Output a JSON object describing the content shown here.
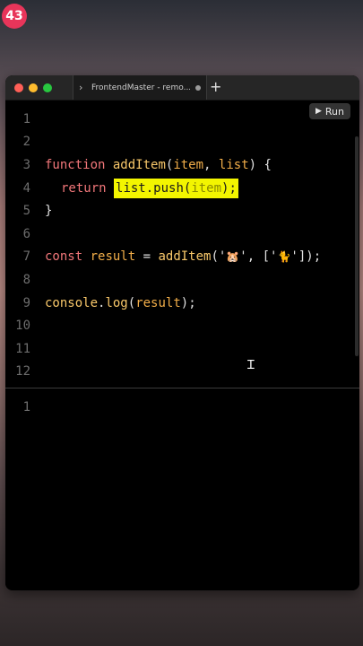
{
  "badge": "43",
  "window": {
    "tab_title": "FrontendMaster - remo...",
    "new_tab_symbol": "+",
    "run_label": "Run",
    "run_icon": "▶"
  },
  "editor": {
    "line_numbers": [
      "1",
      "2",
      "3",
      "4",
      "5",
      "6",
      "7",
      "8",
      "9",
      "10",
      "11",
      "12"
    ],
    "line3": {
      "kw": "function",
      "fn": "addItem",
      "p1": "(",
      "a1": "item",
      "c1": ", ",
      "a2": "list",
      "p2": ") {"
    },
    "line4": {
      "kw": "return",
      "hl_a": "list",
      "hl_b": ".push(",
      "hl_c": "item",
      "hl_d": ");"
    },
    "line5": {
      "brace": "}"
    },
    "line7": {
      "kw": "const",
      "v": "result",
      "eq": " = ",
      "fn": "addItem",
      "o": "('",
      "e1": "🐹",
      "m": "', ['",
      "e2": "🐈",
      "c": "']);"
    },
    "line9": {
      "a": "console",
      "b": ".",
      "c": "log",
      "d": "(",
      "e": "result",
      "f": ");"
    }
  },
  "output": {
    "line_numbers": [
      "1"
    ]
  },
  "colors": {
    "highlight": "#f3f500",
    "badge": "#e8355a"
  }
}
